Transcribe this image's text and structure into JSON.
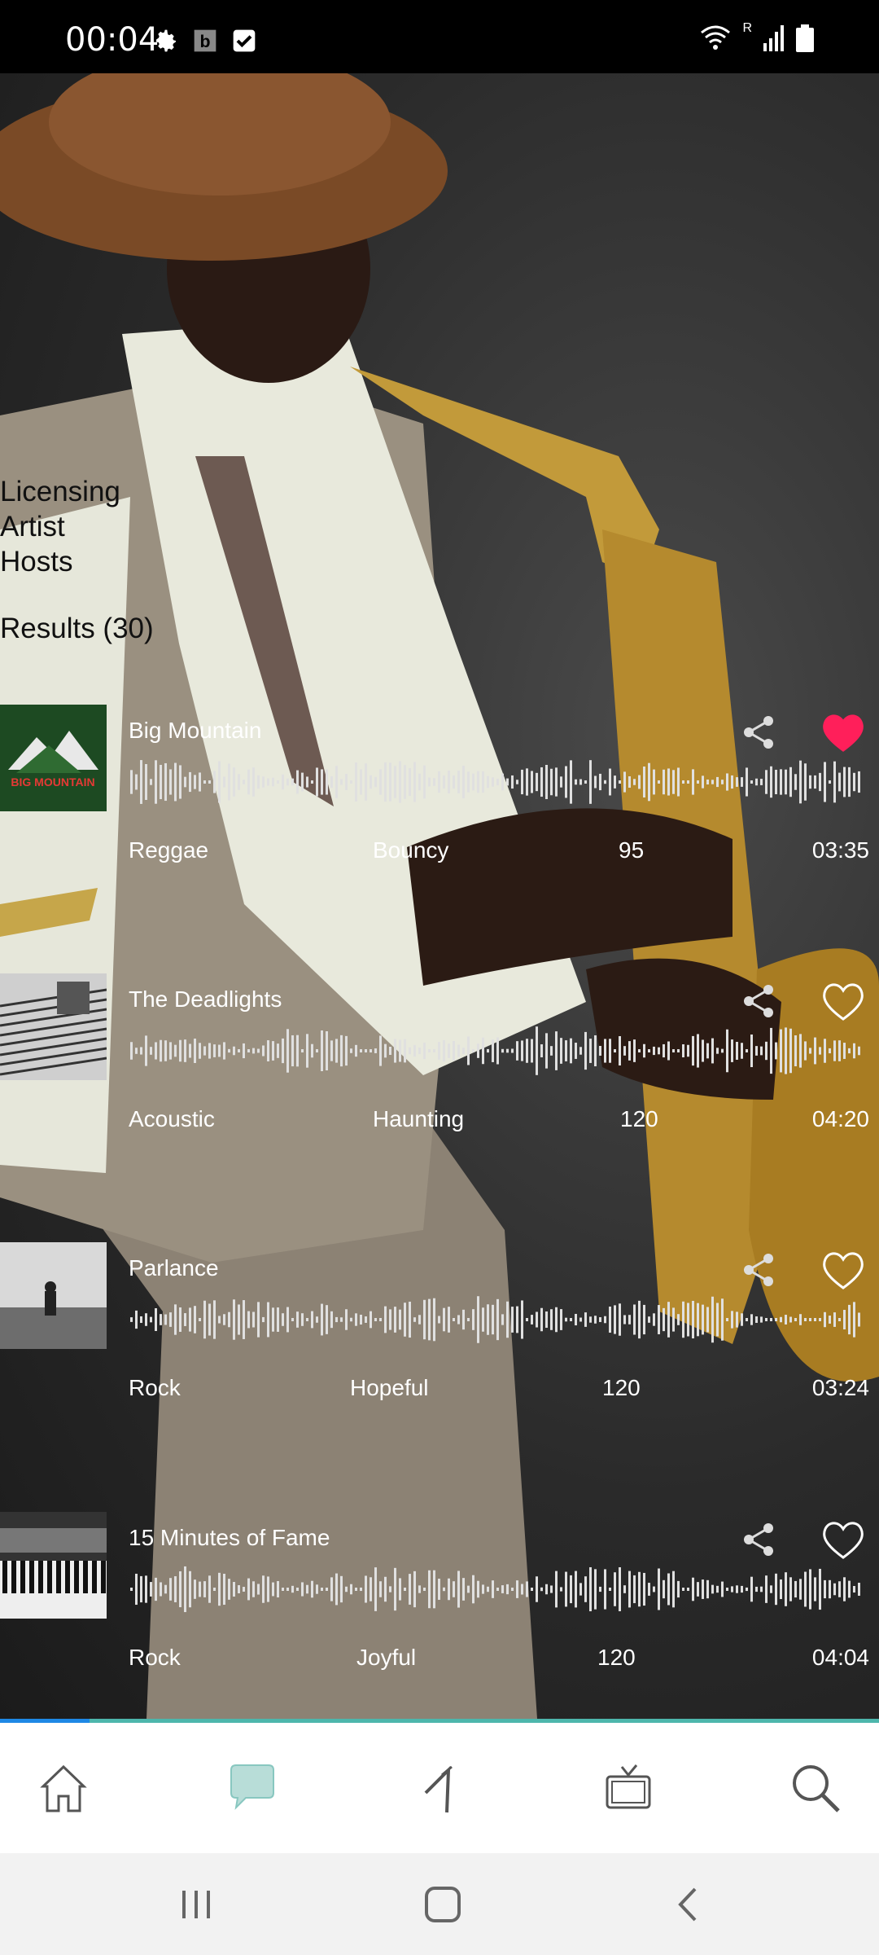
{
  "status_bar": {
    "time": "00:04",
    "left_icons": [
      "gear-icon",
      "b-app-icon",
      "checkbox-icon"
    ],
    "right_icons": [
      "wifi-icon",
      "signal-icon",
      "battery-icon"
    ],
    "roaming_label": "R"
  },
  "menu": {
    "items": [
      "Licensing",
      "Artist",
      "Hosts"
    ]
  },
  "results_label": "Results (30)",
  "tracks": [
    {
      "title": "Big Mountain",
      "genre": "Reggae",
      "mood": "Bouncy",
      "bpm": "95",
      "duration": "03:35",
      "favorited": true,
      "thumb": "album-art-big-mountain",
      "thumb_text": "BIG MOUNTAIN"
    },
    {
      "title": "The Deadlights",
      "genre": "Acoustic",
      "mood": "Haunting",
      "bpm": "120",
      "duration": "04:20",
      "favorited": false,
      "thumb": "album-art-stairs"
    },
    {
      "title": "Parlance",
      "genre": "Rock",
      "mood": "Hopeful",
      "bpm": "120",
      "duration": "03:24",
      "favorited": false,
      "thumb": "album-art-rooftop"
    },
    {
      "title": "15 Minutes of Fame",
      "genre": "Rock",
      "mood": "Joyful",
      "bpm": "120",
      "duration": "04:04",
      "favorited": false,
      "thumb": "album-art-keyboard"
    }
  ],
  "bottom_nav": [
    "home-icon",
    "chat-icon",
    "feed-icon",
    "tv-icon",
    "search-icon"
  ],
  "colors": {
    "accent": "#4db6ac",
    "favorite": "#ff1f5a",
    "chat_active": "#b8ddd8"
  },
  "system_nav": [
    "recents-button",
    "home-button",
    "back-button"
  ]
}
